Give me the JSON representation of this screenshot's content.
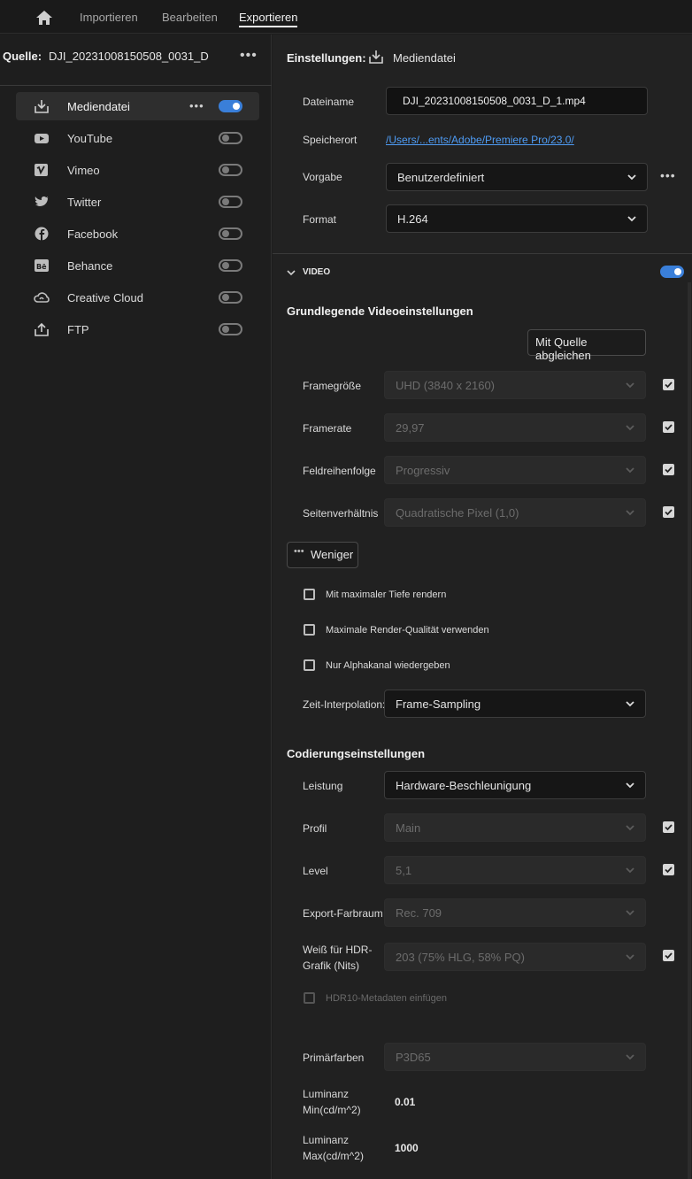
{
  "nav": {
    "tabs": [
      "Importieren",
      "Bearbeiten",
      "Exportieren"
    ],
    "active": "Exportieren"
  },
  "source": {
    "label": "Quelle:",
    "name": "DJI_20231008150508_0031_D"
  },
  "destinations": [
    {
      "label": "Mediendatei",
      "icon": "download-tray-icon",
      "enabled": true,
      "selected": true
    },
    {
      "label": "YouTube",
      "icon": "youtube-icon",
      "enabled": false
    },
    {
      "label": "Vimeo",
      "icon": "vimeo-icon",
      "enabled": false
    },
    {
      "label": "Twitter",
      "icon": "twitter-icon",
      "enabled": false
    },
    {
      "label": "Facebook",
      "icon": "facebook-icon",
      "enabled": false
    },
    {
      "label": "Behance",
      "icon": "behance-icon",
      "enabled": false
    },
    {
      "label": "Creative Cloud",
      "icon": "creative-cloud-icon",
      "enabled": false
    },
    {
      "label": "FTP",
      "icon": "upload-icon",
      "enabled": false
    }
  ],
  "settings": {
    "heading": "Einstellungen:",
    "target": "Mediendatei",
    "filename_label": "Dateiname",
    "filename": "DJI_20231008150508_0031_D_1.mp4",
    "location_label": "Speicherort",
    "location": "/Users/...ents/Adobe/Premiere Pro/23.0/",
    "preset_label": "Vorgabe",
    "preset": "Benutzerdefiniert",
    "format_label": "Format",
    "format": "H.264"
  },
  "video": {
    "section": "VIDEO",
    "enabled": true,
    "basic_heading": "Grundlegende Videoeinstellungen",
    "match_source": "Mit Quelle abgleichen",
    "frame_size_label": "Framegröße",
    "frame_size": "UHD (3840 x 2160)",
    "frame_rate_label": "Framerate",
    "frame_rate": "29,97",
    "field_order_label": "Feldreihenfolge",
    "field_order": "Progressiv",
    "aspect_label": "Seitenverhältnis",
    "aspect": "Quadratische Pixel (1,0)",
    "less_button": "Weniger",
    "max_depth": "Mit maximaler Tiefe rendern",
    "max_quality": "Maximale Render-Qualität verwenden",
    "alpha_only": "Nur Alphakanal wiedergeben",
    "time_interp_label": "Zeit-Interpolation:",
    "time_interp": "Frame-Sampling"
  },
  "encoding": {
    "heading": "Codierungseinstellungen",
    "performance_label": "Leistung",
    "performance": "Hardware-Beschleunigung",
    "profile_label": "Profil",
    "profile": "Main",
    "level_label": "Level",
    "level": "5,1",
    "color_space_label": "Export-Farbraum",
    "color_space": "Rec. 709",
    "hdr_white_label_1": "Weiß für HDR-",
    "hdr_white_label_2": "Grafik (Nits)",
    "hdr_white": "203 (75% HLG, 58% PQ)",
    "hdr10_meta": "HDR10-Metadaten einfügen",
    "primaries_label": "Primärfarben",
    "primaries": "P3D65",
    "lum_min_label_1": "Luminanz",
    "lum_min_label_2": "Min(cd/m^2)",
    "lum_min": "0.01",
    "lum_max_label_1": "Luminanz",
    "lum_max_label_2": "Max(cd/m^2)",
    "lum_max": "1000"
  },
  "colors": {
    "accent": "#3a7fd9",
    "link": "#4e9cf5"
  }
}
